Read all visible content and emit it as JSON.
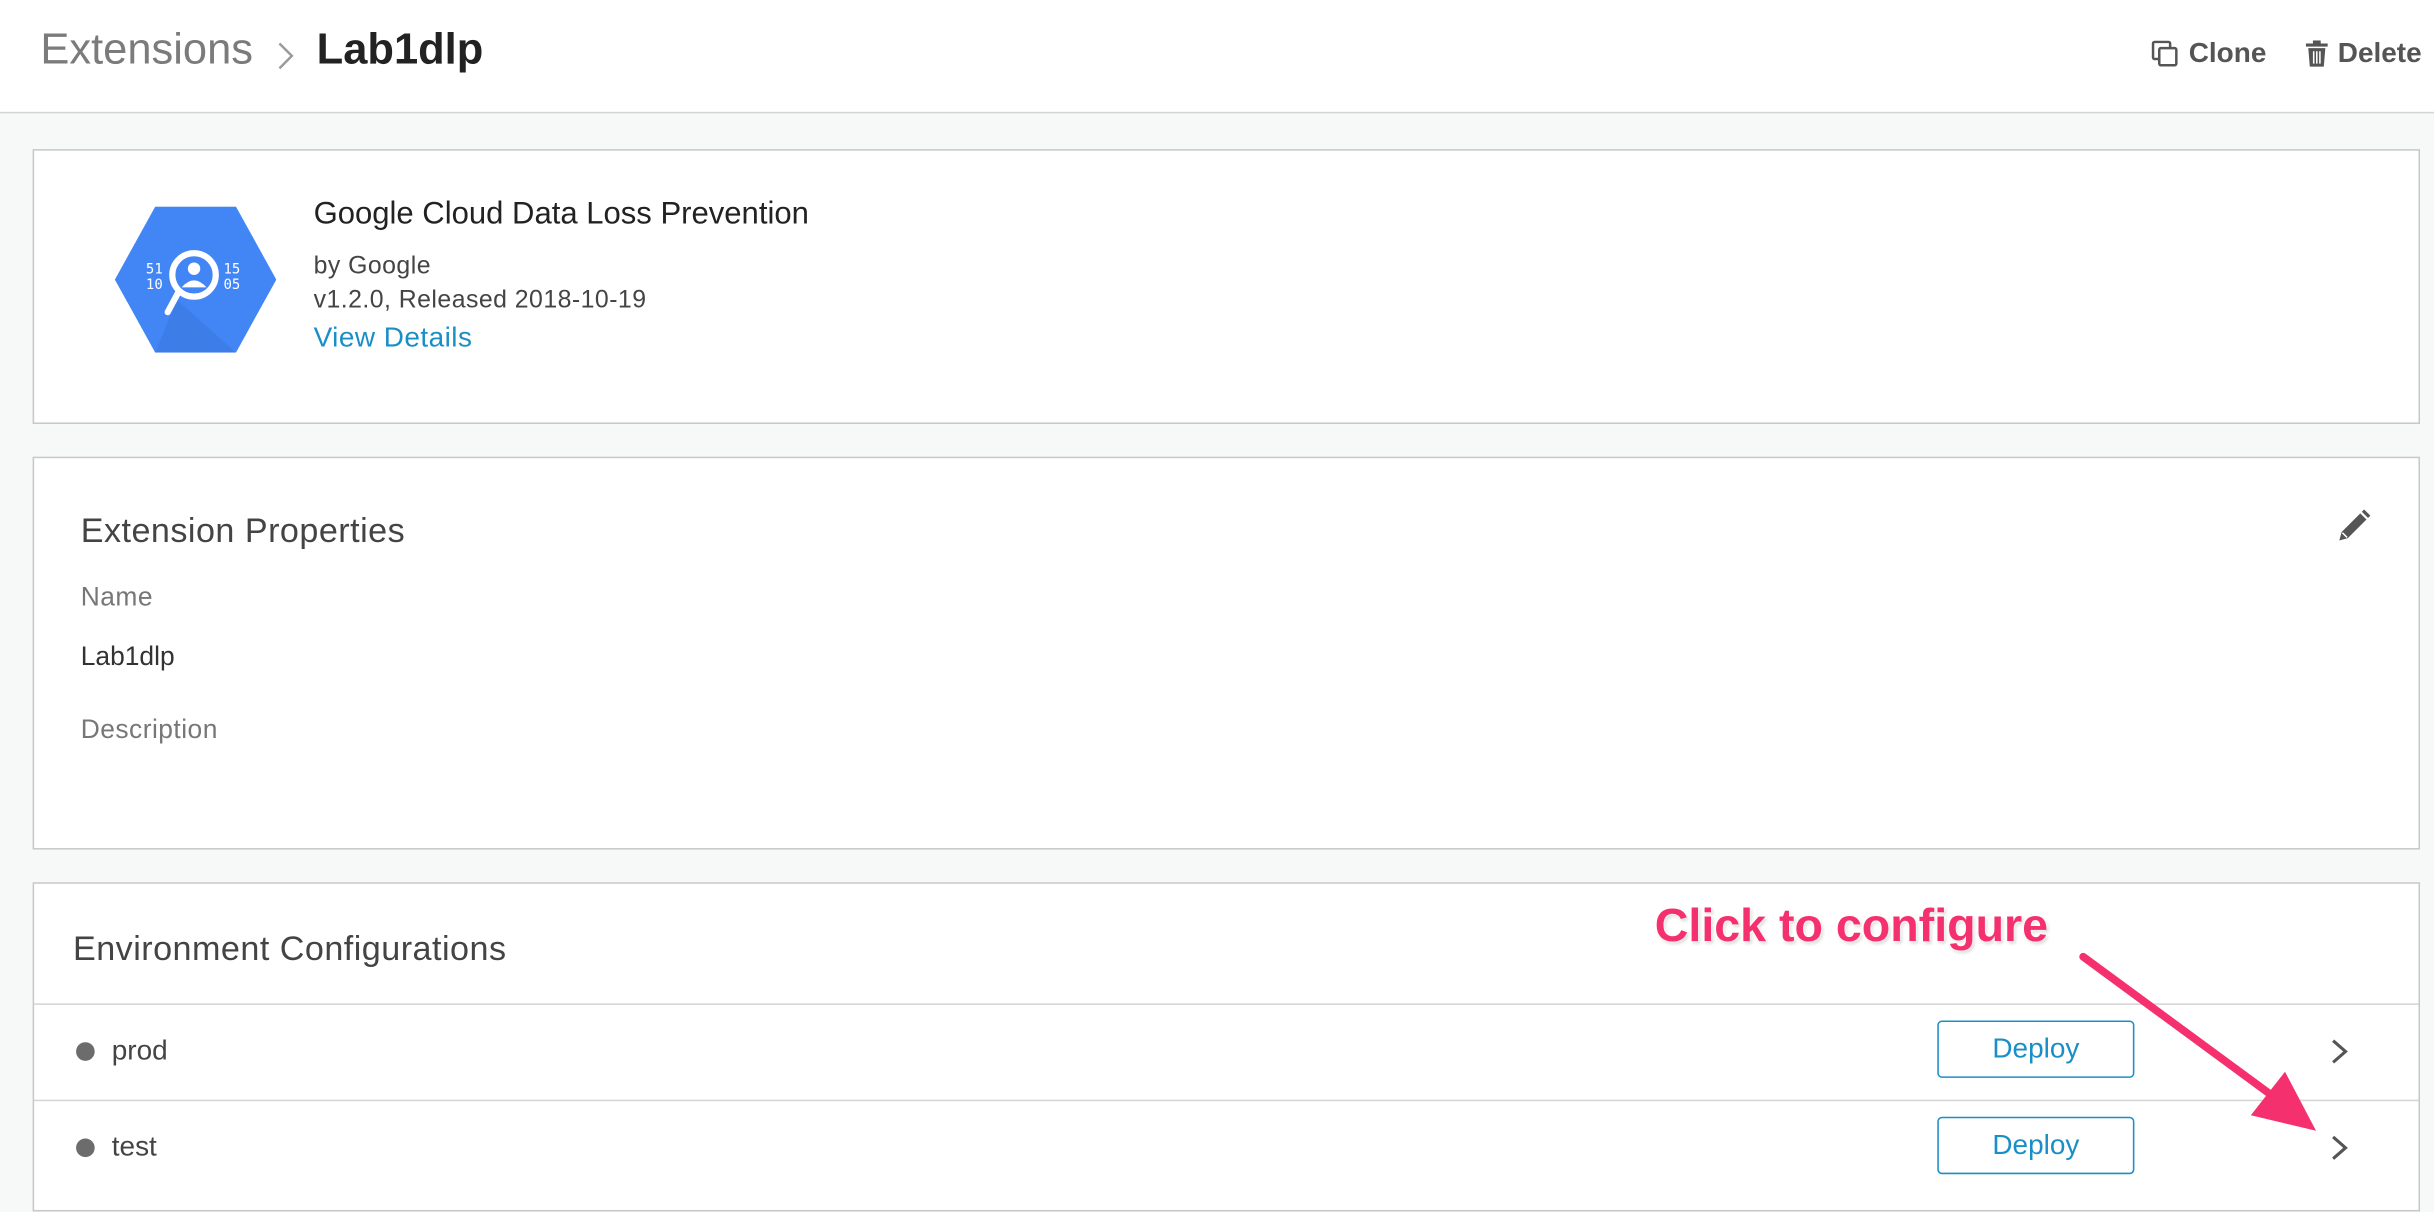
{
  "breadcrumb": {
    "root": "Extensions",
    "current": "Lab1dlp"
  },
  "header_actions": {
    "clone": "Clone",
    "delete": "Delete"
  },
  "extension": {
    "title": "Google Cloud Data Loss Prevention",
    "publisher": "by Google",
    "version": "v1.2.0, Released 2018-10-19",
    "details_link": "View Details",
    "logo_text": {
      "left_top": "51",
      "left_bottom": "10",
      "right_top": "15",
      "right_bottom": "05"
    }
  },
  "properties": {
    "title": "Extension Properties",
    "name_label": "Name",
    "name_value": "Lab1dlp",
    "description_label": "Description",
    "description_value": ""
  },
  "environments": {
    "title": "Environment Configurations",
    "rows": [
      {
        "name": "prod",
        "button": "Deploy"
      },
      {
        "name": "test",
        "button": "Deploy"
      }
    ]
  },
  "annotation": {
    "text": "Click to configure",
    "color": "#f5306e"
  },
  "colors": {
    "link": "#1a8fc7",
    "logo": "#4285f4",
    "status_dot": "#6c6c6c"
  }
}
